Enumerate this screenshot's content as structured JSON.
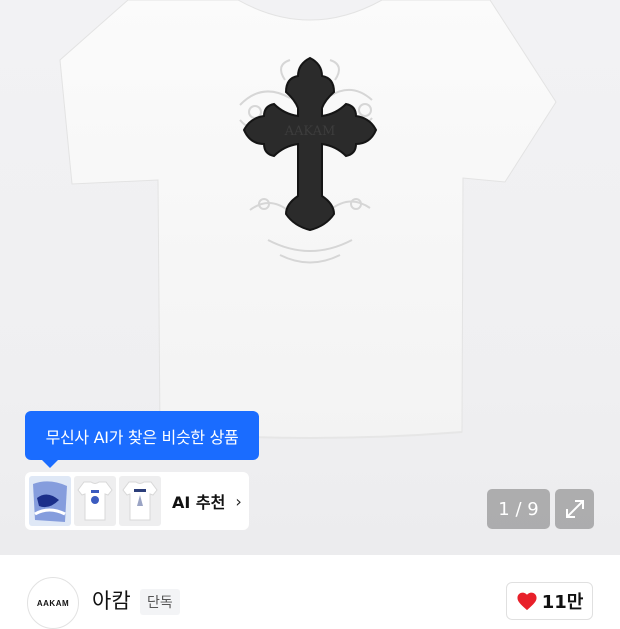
{
  "product": {
    "print_text": "AAKAM"
  },
  "ai": {
    "tooltip": "무신사 AI가 찾은 비슷한 상품",
    "recommend_label": "AI 추천",
    "arrow": "›",
    "thumbnails": [
      {
        "icon": "blue-graphic-thumb"
      },
      {
        "icon": "white-tee-thumb"
      },
      {
        "icon": "white-tee-thumb"
      }
    ]
  },
  "gallery": {
    "page_indicator": "1 / 9",
    "current": 1,
    "total": 9
  },
  "brand": {
    "logo_text": "AAKAM",
    "name": "아캄",
    "badge": "단독"
  },
  "like": {
    "count": "11만",
    "icon": "heart-icon",
    "color": "#e8202a"
  },
  "colors": {
    "accent": "#1a6cff"
  }
}
